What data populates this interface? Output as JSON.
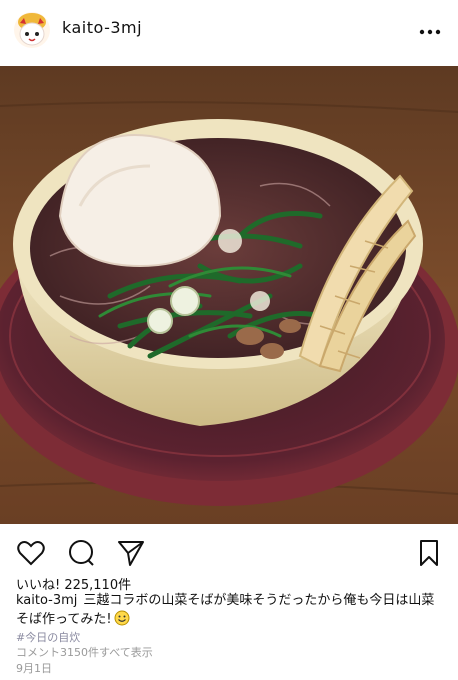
{
  "post": {
    "username": "kaito-3mj",
    "likes": "いいね! 225,110件",
    "caption_user": "kaito-3mj",
    "caption_text": "三越コラボの山菜そばが美味そうだったから俺も今日は山菜そば作ってみた!",
    "hashtag": "#今日の自炊",
    "comments": "コメント3150件すべて表示",
    "date": "9月1日"
  },
  "icons": {
    "more": "more-dots-icon",
    "like": "heart-icon",
    "comment": "comment-icon",
    "share": "send-icon",
    "save": "bookmark-icon"
  },
  "colors": {
    "tray": "#7a2a33",
    "bowl": "#e8d9a9",
    "broth": "#4a2a2a",
    "wood": "#7a4b2a"
  }
}
